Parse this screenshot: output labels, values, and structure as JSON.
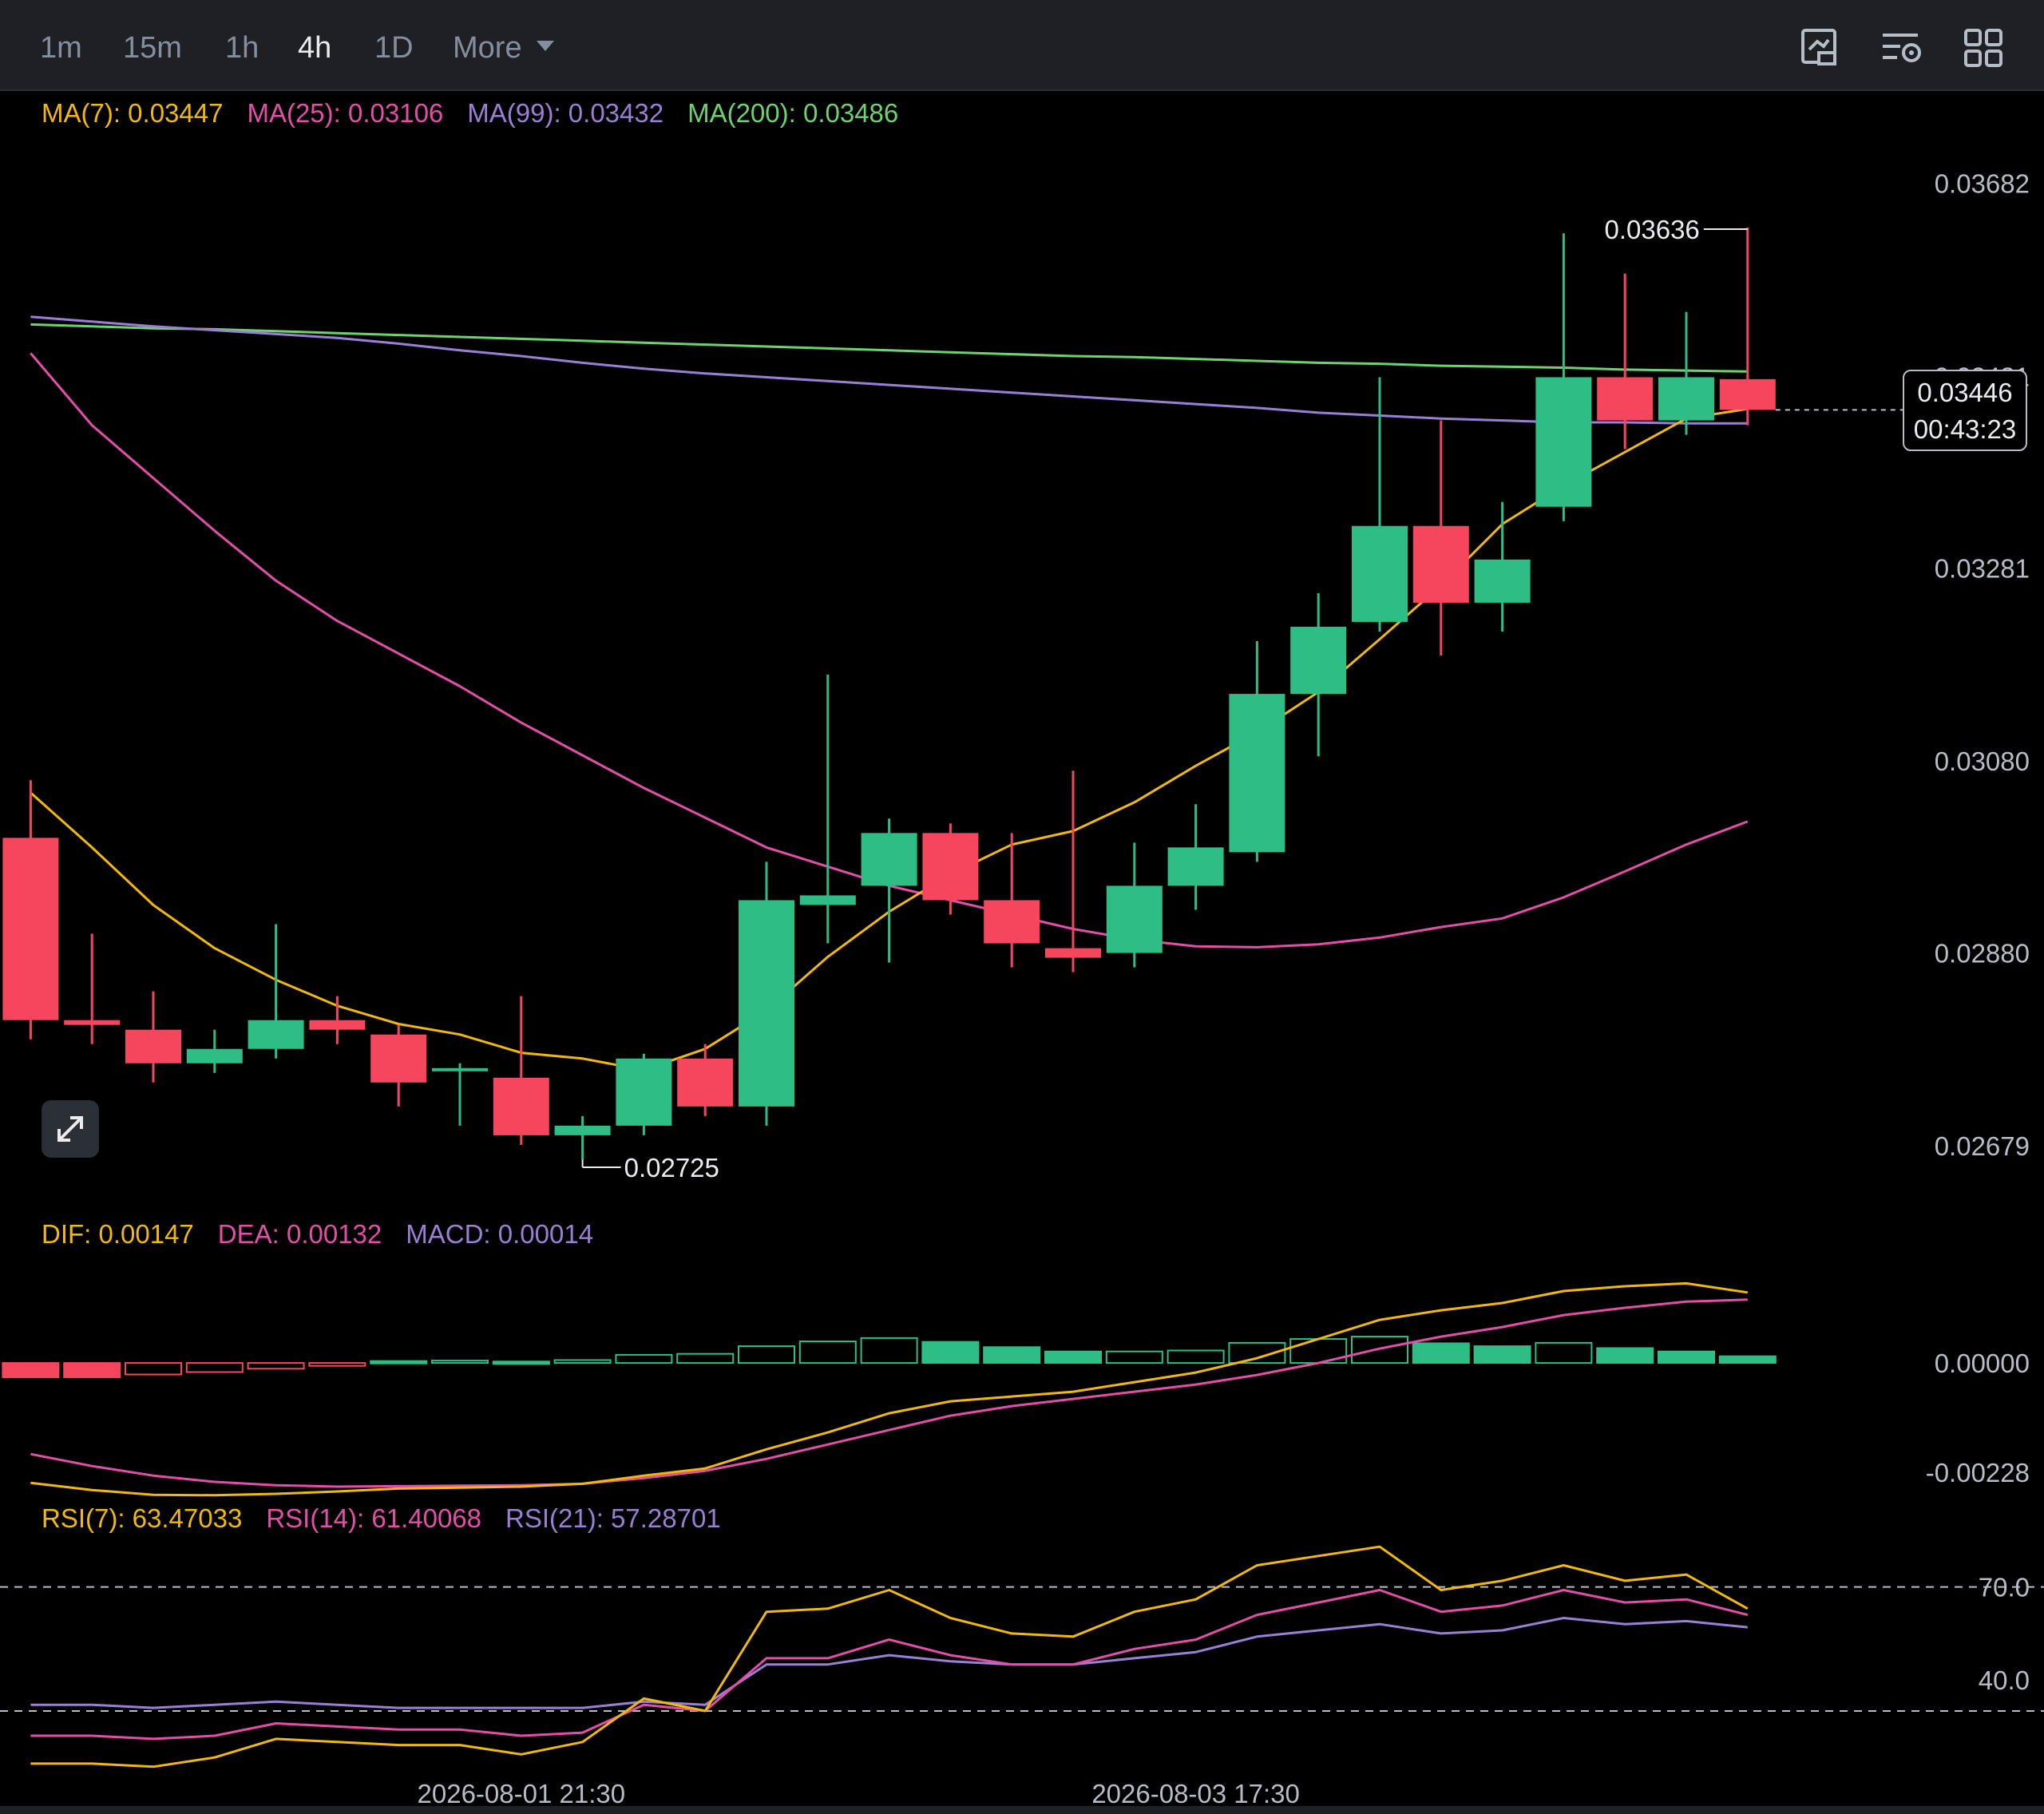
{
  "toolbar": {
    "timeframes": [
      "1m",
      "15m",
      "1h",
      "4h",
      "1D"
    ],
    "active_timeframe": "4h",
    "more_label": "More",
    "icons": [
      "chart-screenshot-icon",
      "indicator-settings-icon",
      "layout-grid-icon"
    ]
  },
  "colors": {
    "up": "#2ebd85",
    "down": "#f6465d",
    "ma7": "#f0b90b",
    "ma25": "#e34fa8",
    "ma99": "#9b7fd4",
    "ma200": "#6ed36e",
    "dif": "#f0b90b",
    "dea": "#e34fa8",
    "macd": "#9b7fd4",
    "rsi7": "#f0b90b",
    "rsi14": "#e34fa8",
    "rsi21": "#9b7fd4"
  },
  "legend": {
    "ma": [
      {
        "label": "MA(7): 0.03447",
        "color": "#f0b90b"
      },
      {
        "label": "MA(25): 0.03106",
        "color": "#e34fa8"
      },
      {
        "label": "MA(99): 0.03432",
        "color": "#9b7fd4"
      },
      {
        "label": "MA(200): 0.03486",
        "color": "#6ed36e"
      }
    ],
    "macd": [
      {
        "label": "DIF: 0.00147",
        "color": "#f0b90b"
      },
      {
        "label": "DEA: 0.00132",
        "color": "#e34fa8"
      },
      {
        "label": "MACD: 0.00014",
        "color": "#9b7fd4"
      }
    ],
    "rsi": [
      {
        "label": "RSI(7): 63.47033",
        "color": "#f0b90b"
      },
      {
        "label": "RSI(14): 61.40068",
        "color": "#e34fa8"
      },
      {
        "label": "RSI(21): 57.28701",
        "color": "#9b7fd4"
      }
    ]
  },
  "current_price": {
    "price": "0.03446",
    "countdown": "00:43:23"
  },
  "chart_data": {
    "type": "candlestick",
    "price_axis_ticks": [
      "0.03682",
      "0.03481",
      "0.03281",
      "0.03080",
      "0.02880",
      "0.02679"
    ],
    "price_ylim": [
      0.0264,
      0.0374
    ],
    "high_marker": "0.03636",
    "low_marker": "0.02725",
    "time_labels": [
      "2026-08-01 21:30",
      "2026-08-03 17:30"
    ],
    "candles": [
      {
        "o": 0.03,
        "h": 0.0306,
        "l": 0.0279,
        "c": 0.0281
      },
      {
        "o": 0.0281,
        "h": 0.029,
        "l": 0.02785,
        "c": 0.02805
      },
      {
        "o": 0.028,
        "h": 0.0284,
        "l": 0.02745,
        "c": 0.02765
      },
      {
        "o": 0.02765,
        "h": 0.028,
        "l": 0.02755,
        "c": 0.0278
      },
      {
        "o": 0.0278,
        "h": 0.0291,
        "l": 0.0277,
        "c": 0.0281
      },
      {
        "o": 0.0281,
        "h": 0.02835,
        "l": 0.02785,
        "c": 0.028
      },
      {
        "o": 0.02795,
        "h": 0.02805,
        "l": 0.0272,
        "c": 0.02745
      },
      {
        "o": 0.0276,
        "h": 0.02765,
        "l": 0.027,
        "c": 0.0276
      },
      {
        "o": 0.0275,
        "h": 0.02835,
        "l": 0.0268,
        "c": 0.0269
      },
      {
        "o": 0.0269,
        "h": 0.0271,
        "l": 0.02665,
        "c": 0.027
      },
      {
        "o": 0.027,
        "h": 0.02775,
        "l": 0.0269,
        "c": 0.0277
      },
      {
        "o": 0.0277,
        "h": 0.02785,
        "l": 0.0271,
        "c": 0.0272
      },
      {
        "o": 0.0272,
        "h": 0.02975,
        "l": 0.027,
        "c": 0.02935
      },
      {
        "o": 0.0293,
        "h": 0.0317,
        "l": 0.0289,
        "c": 0.0294
      },
      {
        "o": 0.0295,
        "h": 0.0302,
        "l": 0.0287,
        "c": 0.03005
      },
      {
        "o": 0.03005,
        "h": 0.03015,
        "l": 0.0292,
        "c": 0.02935
      },
      {
        "o": 0.02935,
        "h": 0.03005,
        "l": 0.02865,
        "c": 0.0289
      },
      {
        "o": 0.02885,
        "h": 0.0307,
        "l": 0.0286,
        "c": 0.02875
      },
      {
        "o": 0.0288,
        "h": 0.02995,
        "l": 0.02865,
        "c": 0.0295
      },
      {
        "o": 0.0295,
        "h": 0.03035,
        "l": 0.02925,
        "c": 0.0299
      },
      {
        "o": 0.02985,
        "h": 0.03205,
        "l": 0.02975,
        "c": 0.0315
      },
      {
        "o": 0.0315,
        "h": 0.03255,
        "l": 0.03085,
        "c": 0.0322
      },
      {
        "o": 0.03225,
        "h": 0.0348,
        "l": 0.03215,
        "c": 0.03325
      },
      {
        "o": 0.03325,
        "h": 0.03435,
        "l": 0.0319,
        "c": 0.03245
      },
      {
        "o": 0.03245,
        "h": 0.0335,
        "l": 0.03215,
        "c": 0.0329
      },
      {
        "o": 0.03345,
        "h": 0.0363,
        "l": 0.0333,
        "c": 0.0348
      },
      {
        "o": 0.0348,
        "h": 0.03588,
        "l": 0.03405,
        "c": 0.03435
      },
      {
        "o": 0.03435,
        "h": 0.03548,
        "l": 0.0342,
        "c": 0.0348
      },
      {
        "o": 0.03478,
        "h": 0.03636,
        "l": 0.0343,
        "c": 0.03446
      }
    ],
    "ma7": [
      0.03047,
      0.0299,
      0.0293,
      0.02885,
      0.02852,
      0.02825,
      0.02806,
      0.02795,
      0.02776,
      0.0277,
      0.02758,
      0.0278,
      0.0282,
      0.02876,
      0.02923,
      0.02962,
      0.02993,
      0.03007,
      0.03037,
      0.03075,
      0.0311,
      0.03152,
      0.03207,
      0.03263,
      0.03327,
      0.03367,
      0.03402,
      0.03437,
      0.03447
    ],
    "ma25": [
      0.03505,
      0.0343,
      0.03375,
      0.0332,
      0.03268,
      0.03226,
      0.03192,
      0.03158,
      0.0312,
      0.03086,
      0.03052,
      0.03021,
      0.0299,
      0.0297,
      0.0295,
      0.02935,
      0.0292,
      0.02905,
      0.02894,
      0.02887,
      0.02886,
      0.02889,
      0.02896,
      0.02907,
      0.02916,
      0.02938,
      0.02965,
      0.02993,
      0.03017
    ],
    "ma99": [
      0.03543,
      0.03538,
      0.03533,
      0.03529,
      0.03525,
      0.03521,
      0.03515,
      0.03508,
      0.03502,
      0.03495,
      0.03489,
      0.03484,
      0.0348,
      0.03476,
      0.03472,
      0.03468,
      0.03464,
      0.0346,
      0.03456,
      0.03452,
      0.03448,
      0.03443,
      0.0344,
      0.03437,
      0.03435,
      0.03433,
      0.03433,
      0.03432,
      0.03432
    ],
    "ma200": [
      0.03535,
      0.03533,
      0.03531,
      0.0353,
      0.03528,
      0.03526,
      0.03524,
      0.03522,
      0.0352,
      0.03518,
      0.03516,
      0.03514,
      0.03512,
      0.0351,
      0.03508,
      0.03506,
      0.03504,
      0.03502,
      0.03501,
      0.03499,
      0.03497,
      0.03495,
      0.03494,
      0.03492,
      0.03491,
      0.0349,
      0.03488,
      0.03487,
      0.03486
    ],
    "macd_axis_ticks": [
      "0.00000",
      "-0.00228"
    ],
    "macd_ylim": [
      -0.00288,
      0.00245
    ],
    "macd_hist": [
      -0.0003,
      -0.0003,
      -0.00024,
      -0.00019,
      -0.00012,
      -6e-05,
      4e-05,
      5e-05,
      3e-05,
      6e-05,
      0.00017,
      0.00019,
      0.00035,
      0.00045,
      0.00052,
      0.00044,
      0.00033,
      0.00024,
      0.00024,
      0.00026,
      0.00042,
      0.0005,
      0.00055,
      0.00041,
      0.00035,
      0.00042,
      0.00031,
      0.00024,
      0.00014
    ],
    "dif": [
      -0.0025,
      -0.00265,
      -0.00275,
      -0.00276,
      -0.00273,
      -0.00268,
      -0.00262,
      -0.0026,
      -0.00258,
      -0.00252,
      -0.00235,
      -0.0022,
      -0.0018,
      -0.00145,
      -0.00105,
      -0.0008,
      -0.0007,
      -0.0006,
      -0.0004,
      -0.0002,
      0.0001,
      0.0005,
      0.0009,
      0.0011,
      0.00125,
      0.0015,
      0.0016,
      0.00166,
      0.00147
    ],
    "dea": [
      -0.0019,
      -0.00215,
      -0.00235,
      -0.00248,
      -0.00255,
      -0.00258,
      -0.00257,
      -0.00256,
      -0.00255,
      -0.00252,
      -0.0024,
      -0.00225,
      -0.002,
      -0.0017,
      -0.0014,
      -0.0011,
      -0.0009,
      -0.00075,
      -0.0006,
      -0.00045,
      -0.00025,
      0.0,
      0.0003,
      0.00055,
      0.00075,
      0.001,
      0.00115,
      0.00128,
      0.00132
    ],
    "rsi_axis_ticks": [
      "70.0",
      "40.0"
    ],
    "rsi_ylim": [
      5,
      90
    ],
    "rsi_levels": [
      70,
      30
    ],
    "rsi7": [
      13,
      13,
      12,
      15,
      21,
      20,
      19,
      19,
      16,
      20,
      34,
      30,
      62,
      63,
      69,
      60,
      55,
      54,
      62,
      66,
      77,
      80,
      83,
      69,
      72,
      77,
      72,
      74,
      63
    ],
    "rsi14": [
      22,
      22,
      21,
      22,
      26,
      25,
      24,
      24,
      22,
      23,
      32,
      30,
      47,
      47,
      53,
      48,
      45,
      45,
      50,
      53,
      61,
      65,
      69,
      62,
      64,
      69,
      65,
      66,
      61
    ],
    "rsi21": [
      32,
      32,
      31,
      32,
      33,
      32,
      31,
      31,
      31,
      31,
      33,
      32,
      45,
      45,
      48,
      46,
      45,
      45,
      47,
      49,
      54,
      56,
      58,
      55,
      56,
      60,
      58,
      59,
      57
    ]
  }
}
